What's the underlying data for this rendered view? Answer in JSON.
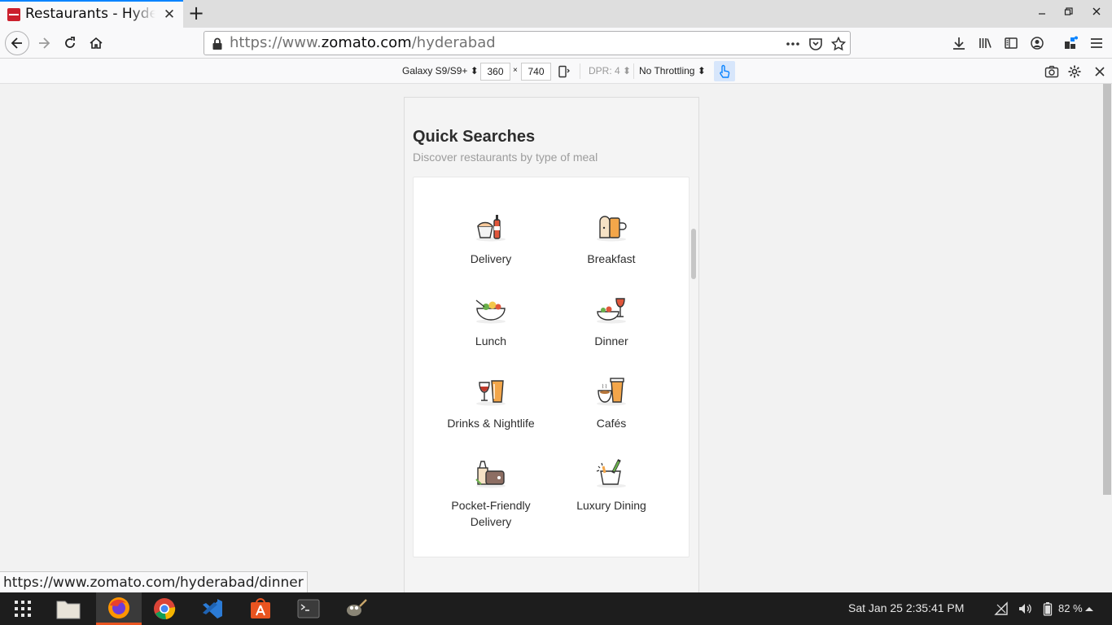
{
  "browser": {
    "tab_title": "Restaurants - Hyderabad",
    "tab_close": "✕",
    "new_tab": "+",
    "url_prefix": "https://www.",
    "url_host": "zomato.com",
    "url_path": "/hyderabad",
    "status_url": "https://www.zomato.com/hyderabad/dinner"
  },
  "rdm": {
    "device": "Galaxy S9/S9+ ⬍",
    "width": "360",
    "times": "×",
    "height": "740",
    "dpr": "DPR: 4 ⬍",
    "throttling": "No Throttling ⬍"
  },
  "page": {
    "title": "Quick Searches",
    "subtitle": "Discover restaurants by type of meal",
    "items": [
      {
        "label": "Delivery",
        "icon": "delivery-icon"
      },
      {
        "label": "Breakfast",
        "icon": "breakfast-icon"
      },
      {
        "label": "Lunch",
        "icon": "lunch-icon"
      },
      {
        "label": "Dinner",
        "icon": "dinner-icon"
      },
      {
        "label": "Drinks & Nightlife",
        "icon": "drinks-icon"
      },
      {
        "label": "Cafés",
        "icon": "cafe-icon"
      },
      {
        "label": "Pocket-Friendly Delivery",
        "icon": "wallet-icon"
      },
      {
        "label": "Luxury Dining",
        "icon": "champagne-icon"
      }
    ]
  },
  "taskbar": {
    "clock": "Sat Jan 25   2:35:41 PM",
    "battery": "82 %"
  },
  "colors": {
    "accent": "#0a84ff",
    "zomato_red": "#cb202d",
    "ubuntu_orange": "#e95420"
  }
}
